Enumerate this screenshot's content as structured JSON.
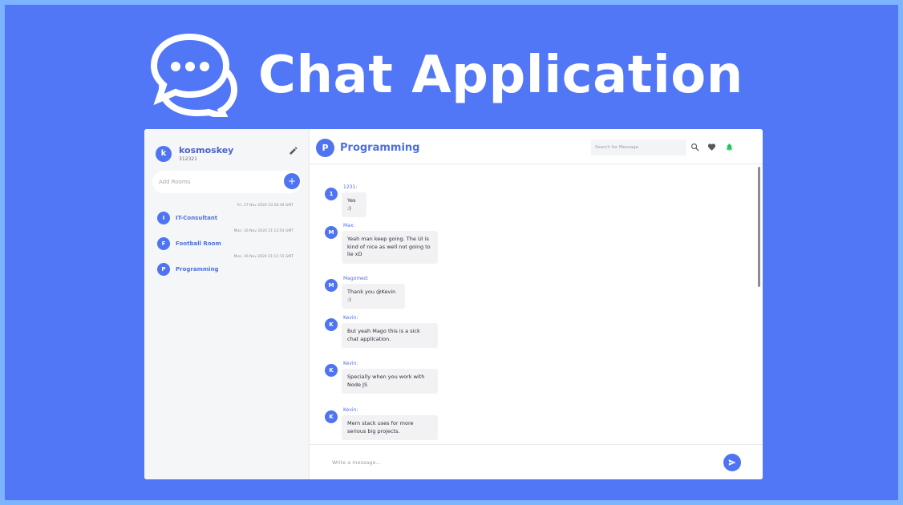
{
  "hero": {
    "title": "Chat Application"
  },
  "colors": {
    "background": "#5176f6",
    "border": "#7db4ff",
    "accent": "#4f74f1",
    "bell": "#22c55e"
  },
  "sidebar": {
    "profile": {
      "avatar_letter": "k",
      "name": "kosmoskey",
      "id": "312321"
    },
    "add_room_placeholder": "Add Rooms",
    "add_room_button": "+",
    "rooms": [
      {
        "letter": "I",
        "name": "IT-Consultant",
        "time": "Fri, 27 Nov 2020 10:28:49 GMT"
      },
      {
        "letter": "F",
        "name": "Football Room",
        "time": "Mon, 16 Nov 2020 21:13:54 GMT"
      },
      {
        "letter": "P",
        "name": "Programming",
        "time": "Mon, 16 Nov 2020 21:11:15 GMT"
      }
    ]
  },
  "main": {
    "room": {
      "letter": "P",
      "title": "Programming"
    },
    "search_placeholder": "Search for Message",
    "icons": [
      "search-icon",
      "heart-icon",
      "bell-icon",
      "send-icon",
      "pencil-icon"
    ],
    "messages": [
      {
        "letter": "1",
        "author": "1231:",
        "text": "Yes :)"
      },
      {
        "letter": "M",
        "author": "Max:",
        "text": "Yeah man keep going. The UI is kind of nice as well not going to lie xD"
      },
      {
        "letter": "M",
        "author": "Magomed:",
        "text": "Thank you @Kevin :)"
      },
      {
        "letter": "K",
        "author": "Kevin:",
        "text": "But yeah Mago this is a sick chat application."
      },
      {
        "letter": "K",
        "author": "Kevin:",
        "text": "Specially when you work with Node JS"
      },
      {
        "letter": "K",
        "author": "Kevin:",
        "text": "Mern stack uses for more serious big projects."
      }
    ],
    "composer_placeholder": "Write a message..."
  }
}
